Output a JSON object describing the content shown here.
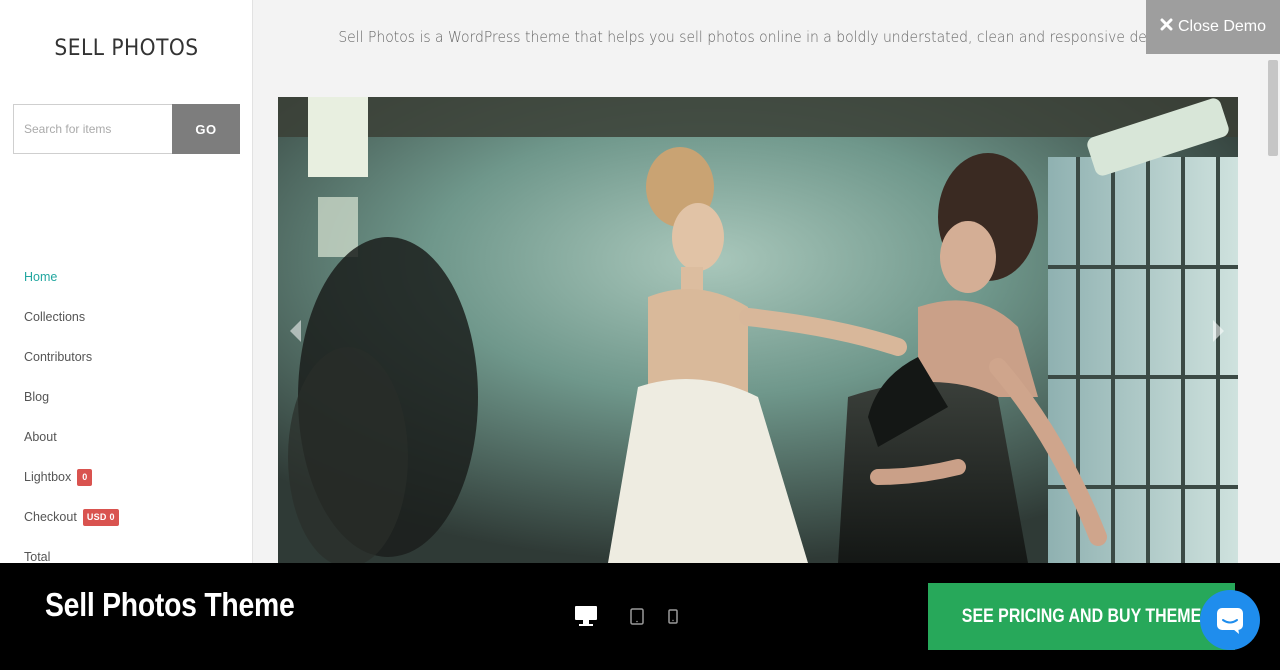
{
  "sidebar": {
    "site_title": "SELL PHOTOS",
    "search": {
      "placeholder": "Search for items",
      "button_label": "GO"
    },
    "nav": [
      {
        "label": "Home",
        "active": true
      },
      {
        "label": "Collections"
      },
      {
        "label": "Contributors"
      },
      {
        "label": "Blog"
      },
      {
        "label": "About"
      },
      {
        "label": "Lightbox",
        "badge": "0"
      },
      {
        "label": "Checkout",
        "badge": "USD 0"
      },
      {
        "label": "Total"
      }
    ]
  },
  "header": {
    "tagline": "Sell Photos is a WordPress theme that helps you sell photos online in a boldly understated, clean and responsive design.",
    "close_demo_label": "Close Demo",
    "close_icon": "close-icon"
  },
  "slider": {
    "image_icon": "hero-photo-two-women-fashion",
    "prev_icon": "chevron-left-icon",
    "next_icon": "chevron-right-icon"
  },
  "bottom_bar": {
    "theme_name": "Sell Photos Theme",
    "devices": [
      "desktop-icon",
      "tablet-icon",
      "mobile-icon"
    ],
    "active_device": "desktop",
    "buy_label": "SEE PRICING AND BUY THEME",
    "chat_icon": "chat-icon"
  },
  "colors": {
    "accent": "#22a7a0",
    "badge": "#d9534f",
    "buy_button": "#27a85a",
    "chat_button": "#1f8ded"
  }
}
